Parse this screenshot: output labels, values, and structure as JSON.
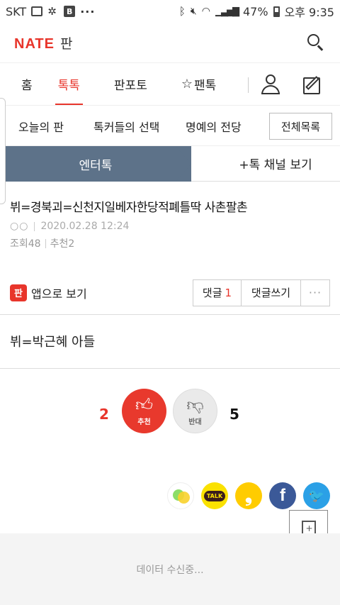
{
  "status_bar": {
    "carrier": "SKT",
    "b_glyph": "B",
    "dots": "···",
    "battery": "47%",
    "time": "오후 9:35"
  },
  "header": {
    "logo_brand": "NATE",
    "logo_section": "판"
  },
  "tabs": {
    "home": "홈",
    "toktok": "톡톡",
    "panpoto": "판포토",
    "pantok": "팬톡",
    "star_glyph": "☆"
  },
  "subnav": {
    "today": "오늘의 판",
    "picks": "톡커들의 선택",
    "hall": "명예의 전당",
    "all_list": "전체목록"
  },
  "channel": {
    "current": "엔터톡",
    "more": "+톡 채널 보기"
  },
  "post": {
    "title": "뷔=경북괴=신천지일베자한당적폐틀딱 사촌팔촌",
    "author": "○○",
    "date": "2020.02.28 12:24",
    "views": "조회48",
    "recommends": "추천2",
    "body": "뷔=박근혜 아들"
  },
  "actions": {
    "app_icon_glyph": "판",
    "app_view": "앱으로 보기",
    "comment_label": "댓글",
    "comment_count": "1",
    "write_comment": "댓글쓰기",
    "more": "···"
  },
  "votes": {
    "up_count": "2",
    "up_label": "추천",
    "down_count": "5",
    "down_label": "반대"
  },
  "share": {
    "kakaotalk_label": "TALK",
    "kakaostory_glyph": "❟",
    "facebook_glyph": "f",
    "twitter_glyph": "🐦"
  },
  "footer": {
    "loading": "데이터 수신중..."
  }
}
